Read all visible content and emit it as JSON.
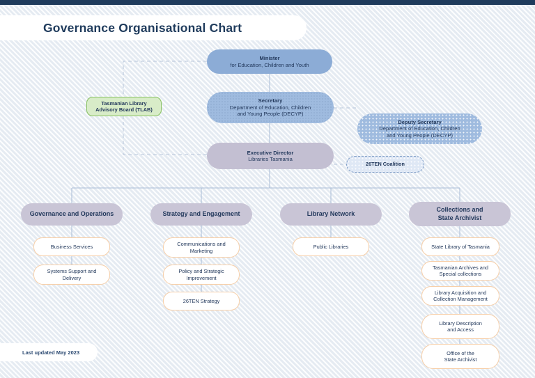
{
  "page": {
    "title": "Governance Organisational Chart",
    "footer_note": "Last updated May 2023",
    "accent_navy": "#1f3b5c",
    "accent_blue": "#8cacd6",
    "accent_green": "#86c05f",
    "accent_lavender": "#c9c5d6",
    "accent_peach": "#f7cfa8"
  },
  "chart_data": {
    "type": "diagram",
    "title": "Governance Organisational Chart",
    "hierarchy": {
      "minister": {
        "title": "Minister",
        "subtitle": "for Education, Children and Youth"
      },
      "secretary": {
        "title": "Secretary",
        "subtitle": "Department of Education, Children and Young People (DECYP)"
      },
      "deputy_secretary": {
        "title": "Deputy Secretary",
        "subtitle": "Department of Education, Children and Young People (DECYP)"
      },
      "executive_director": {
        "title": "Executive Director",
        "subtitle": "Libraries Tasmania"
      },
      "advisory_board": {
        "title": "Tasmanian Library Advisory Board (TLAB)"
      },
      "coalition": {
        "title": "26TEN Coalition"
      }
    },
    "divisions": [
      {
        "name": "Governance and Operations",
        "units": [
          "Business Services",
          "Systems Support and Delivery"
        ]
      },
      {
        "name": "Strategy and Engagement",
        "units": [
          "Communications and Marketing",
          "Policy and Strategic Improvement",
          "26TEN Strategy"
        ]
      },
      {
        "name": "Library Network",
        "units": [
          "Public Libraries"
        ]
      },
      {
        "name": "Collections and State Archivist",
        "units": [
          "State Library of Tasmania",
          "Tasmanian Archives and Special collections",
          "Library Acquisition and Collection Management",
          "Library Description and Access",
          "Office of the State Archivist"
        ]
      }
    ]
  },
  "nodes": {
    "minister_line1": "Minister",
    "minister_line2": "for Education, Children and Youth",
    "secretary_line1": "Secretary",
    "secretary_line2": "Department of Education, Children",
    "secretary_line3": "and Young People (DECYP)",
    "deputy_line1": "Deputy Secretary",
    "deputy_line2": "Department of Education, Children",
    "deputy_line3": "and Young People (DECYP)",
    "exec_line1": "Executive Director",
    "exec_line2": "Libraries Tasmania",
    "tlab_line1": "Tasmanian Library",
    "tlab_line2": "Advisory Board (TLAB)",
    "coalition": "26TEN Coalition",
    "div1": "Governance and Operations",
    "div2": "Strategy and Engagement",
    "div3": "Library Network",
    "div4_line1": "Collections and",
    "div4_line2": "State Archivist",
    "d1u1": "Business Services",
    "d1u2_line1": "Systems Support and",
    "d1u2_line2": "Delivery",
    "d2u1_line1": "Communications and",
    "d2u1_line2": "Marketing",
    "d2u2_line1": "Policy and Strategic",
    "d2u2_line2": "Improvement",
    "d2u3": "26TEN Strategy",
    "d3u1": "Public Libraries",
    "d4u1": "State Library of Tasmania",
    "d4u2_line1": "Tasmanian Archives and",
    "d4u2_line2": "Special collections",
    "d4u3_line1": "Library Acquisition and",
    "d4u3_line2": "Collection Management",
    "d4u4_line1": "Library Description",
    "d4u4_line2": "and Access",
    "d4u5_line1": "Office of the",
    "d4u5_line2": "State Archivist"
  }
}
